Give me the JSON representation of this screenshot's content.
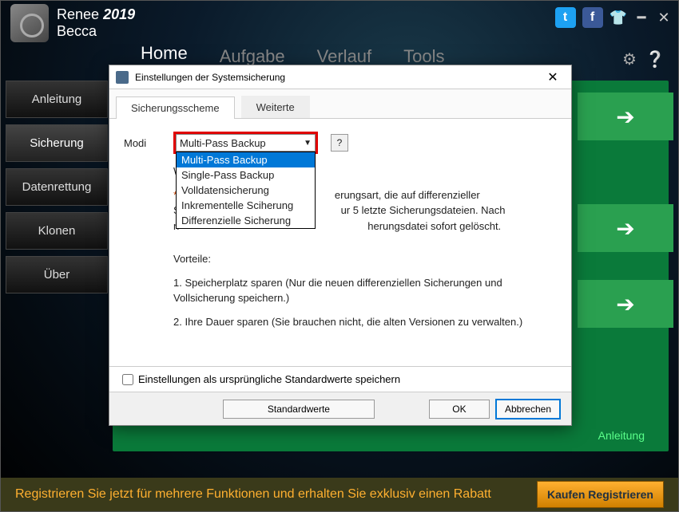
{
  "brand": {
    "name": "Renee",
    "year": "2019",
    "sub": "Becca"
  },
  "nav": {
    "items": [
      "Home",
      "Aufgabe",
      "Verlauf",
      "Tools"
    ],
    "active_index": 0
  },
  "sidebar": {
    "items": [
      {
        "label": "Anleitung"
      },
      {
        "label": "Sicherung"
      },
      {
        "label": "Datenrettung"
      },
      {
        "label": "Klonen"
      },
      {
        "label": "Über"
      }
    ],
    "active_index": 1
  },
  "main": {
    "anleitung_link": "Anleitung"
  },
  "bottombar": {
    "text": "Registrieren Sie jetzt für mehrere Funktionen und erhalten Sie exklusiv einen Rabatt",
    "button": "Kaufen Registrieren"
  },
  "dialog": {
    "title": "Einstellungen der Systemsicherung",
    "tabs": [
      "Sicherungsscheme",
      "Weiterte"
    ],
    "active_tab": 0,
    "modi_label": "Modi",
    "combo_value": "Multi-Pass Backup",
    "combo_options": [
      "Multi-Pass Backup",
      "Single-Pass Backup",
      "Volldatensicherung",
      "Inkrementelle Sciherung",
      "Differenzielle Sicherung"
    ],
    "combo_selected_index": 0,
    "help_q": "?",
    "text": {
      "wa": "Wa",
      "line1_left": "*M",
      "line1_right": "erungsart, die auf differenzieller",
      "line2_left": "Si",
      "line2_right": "ur 5 letzte Sicherungsdateien. Nach",
      "line3_left": "n",
      "line3_right": "herungsdatei sofort gelöscht.",
      "vorteile": "Vorteile:",
      "p1": "1. Speicherplatz sparen (Nur die neuen differenziellen Sicherungen und Vollsicherung speichern.)",
      "p2": "2. Ihre Dauer sparen (Sie brauchen nicht, die alten Versionen zu verwalten.)"
    },
    "footer_check": "Einstellungen als ursprüngliche Standardwerte speichern",
    "buttons": {
      "defaults": "Standardwerte",
      "ok": "OK",
      "cancel": "Abbrechen"
    }
  }
}
